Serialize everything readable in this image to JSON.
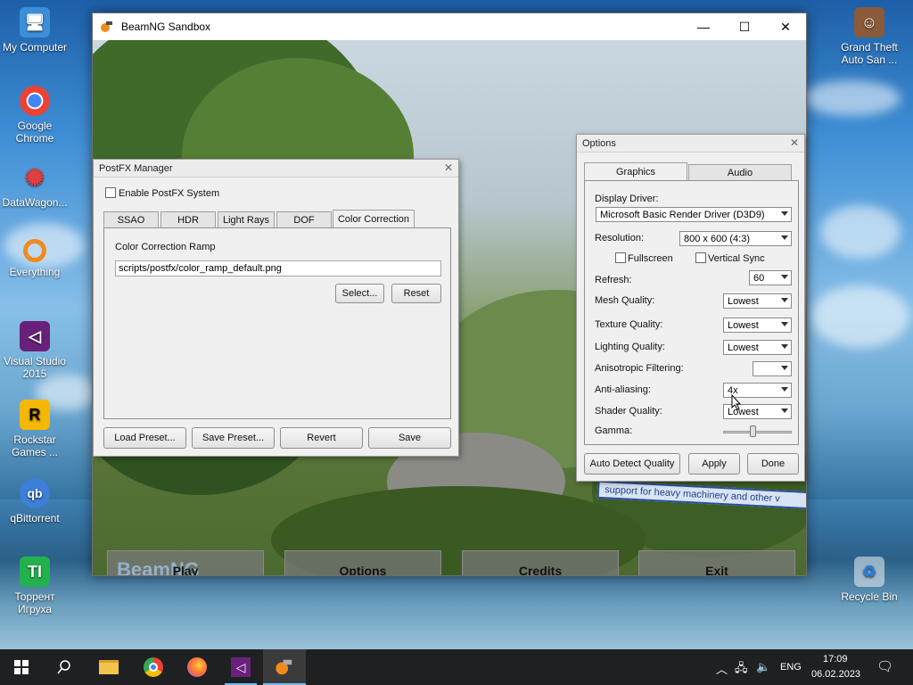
{
  "desktop": {
    "icons_left": [
      {
        "label": "My Computer"
      },
      {
        "label": "Google Chrome"
      },
      {
        "label": "DataWagon..."
      },
      {
        "label": "Everything"
      },
      {
        "label": "Visual Studio 2015"
      },
      {
        "label": "Rockstar Games ..."
      },
      {
        "label": "qBittorrent"
      },
      {
        "label": "Торрент Игруха"
      }
    ],
    "icons_right": [
      {
        "label": "Grand Theft Auto San ..."
      },
      {
        "label": "Recycle Bin"
      }
    ]
  },
  "window": {
    "title": "BeamNG Sandbox",
    "minimize": "—",
    "maximize": "☐",
    "close": "✕"
  },
  "menu": {
    "logo_text": "BeamNG",
    "play": "Play",
    "options": "Options",
    "credits": "Credits",
    "exit": "Exit"
  },
  "sign_text": "support for heavy machinery and other v",
  "postfx": {
    "title": "PostFX Manager",
    "close": "✕",
    "enable_label": "Enable PostFX System",
    "enabled": false,
    "tabs": [
      {
        "label": "SSAO"
      },
      {
        "label": "HDR"
      },
      {
        "label": "Light Rays"
      },
      {
        "label": "DOF"
      },
      {
        "label": "Color Correction"
      }
    ],
    "active_tab": "Color Correction",
    "ramp_label": "Color Correction Ramp",
    "ramp_path": "scripts/postfx/color_ramp_default.png",
    "select_btn": "Select...",
    "reset_btn": "Reset",
    "load_preset": "Load Preset...",
    "save_preset": "Save Preset...",
    "revert": "Revert",
    "save": "Save"
  },
  "options": {
    "title": "Options",
    "close": "✕",
    "tabs": [
      {
        "label": "Graphics"
      },
      {
        "label": "Audio"
      }
    ],
    "active_tab": "Graphics",
    "display_driver_label": "Display Driver:",
    "display_driver": "Microsoft Basic Render Driver (D3D9)",
    "resolution_label": "Resolution:",
    "resolution": "800 x 600  (4:3)",
    "fullscreen_label": "Fullscreen",
    "fullscreen": false,
    "vsync_label": "Vertical Sync",
    "vsync": false,
    "refresh_label": "Refresh:",
    "refresh": "60",
    "mesh_label": "Mesh Quality:",
    "mesh": "Lowest",
    "texture_label": "Texture Quality:",
    "texture": "Lowest",
    "lighting_label": "Lighting Quality:",
    "lighting": "Lowest",
    "aniso_label": "Anisotropic Filtering:",
    "aniso": "",
    "aa_label": "Anti-aliasing:",
    "aa": "4x",
    "shader_label": "Shader Quality:",
    "shader": "Lowest",
    "gamma_label": "Gamma:",
    "auto_detect": "Auto Detect Quality",
    "apply": "Apply",
    "done": "Done"
  },
  "taskbar": {
    "language": "ENG",
    "time": "17:09",
    "date": "06.02.2023"
  }
}
